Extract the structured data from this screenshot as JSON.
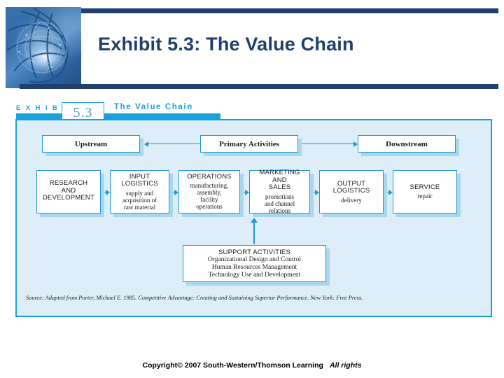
{
  "slide": {
    "title": "Exhibit 5.3: The Value Chain",
    "logo_icon": "abstract-blue-globe-network-image"
  },
  "exhibit": {
    "label": "E X H I B I T",
    "number": "5.3",
    "subtitle": "The Value Chain"
  },
  "diagram": {
    "top_row": [
      {
        "label": "Upstream"
      },
      {
        "label": "Primary Activities"
      },
      {
        "label": "Downstream"
      }
    ],
    "activities": [
      {
        "caption": "RESEARCH\nAND\nDEVELOPMENT",
        "description": ""
      },
      {
        "caption": "INPUT\nLOGISTICS",
        "description": "supply and\nacquisition of\nraw material"
      },
      {
        "caption": "OPERATIONS",
        "description": "manufacturing,\nassembly,\nfacility\noperations"
      },
      {
        "caption": "MARKETING\nAND\nSALES",
        "description": "promotions\nand channel\nrelations"
      },
      {
        "caption": "OUTPUT\nLOGISTICS",
        "description": "delivery"
      },
      {
        "caption": "SERVICE",
        "description": "repair"
      }
    ],
    "support": {
      "caption": "SUPPORT ACTIVITIES",
      "description": "Organizational Design and Control\nHuman Resources Management\nTechnology Use and Development"
    },
    "source": "Source: Adapted from Porter, Michael E. 1985. Competitive Advantage: Creating and Sustaining Superior Performance. New York: Free Press.",
    "colors": {
      "panel_background": "#ddeef8",
      "panel_border": "#1aa0da",
      "box_border": "#2299cf",
      "box_shadow": "#a8d7ee",
      "accent_blue": "#1aa0da",
      "header_navy": "#1f3f6e"
    }
  },
  "footer": {
    "copyright": "Copyright© 2007 South-Western/Thomson Learning",
    "rights": "All rights"
  }
}
